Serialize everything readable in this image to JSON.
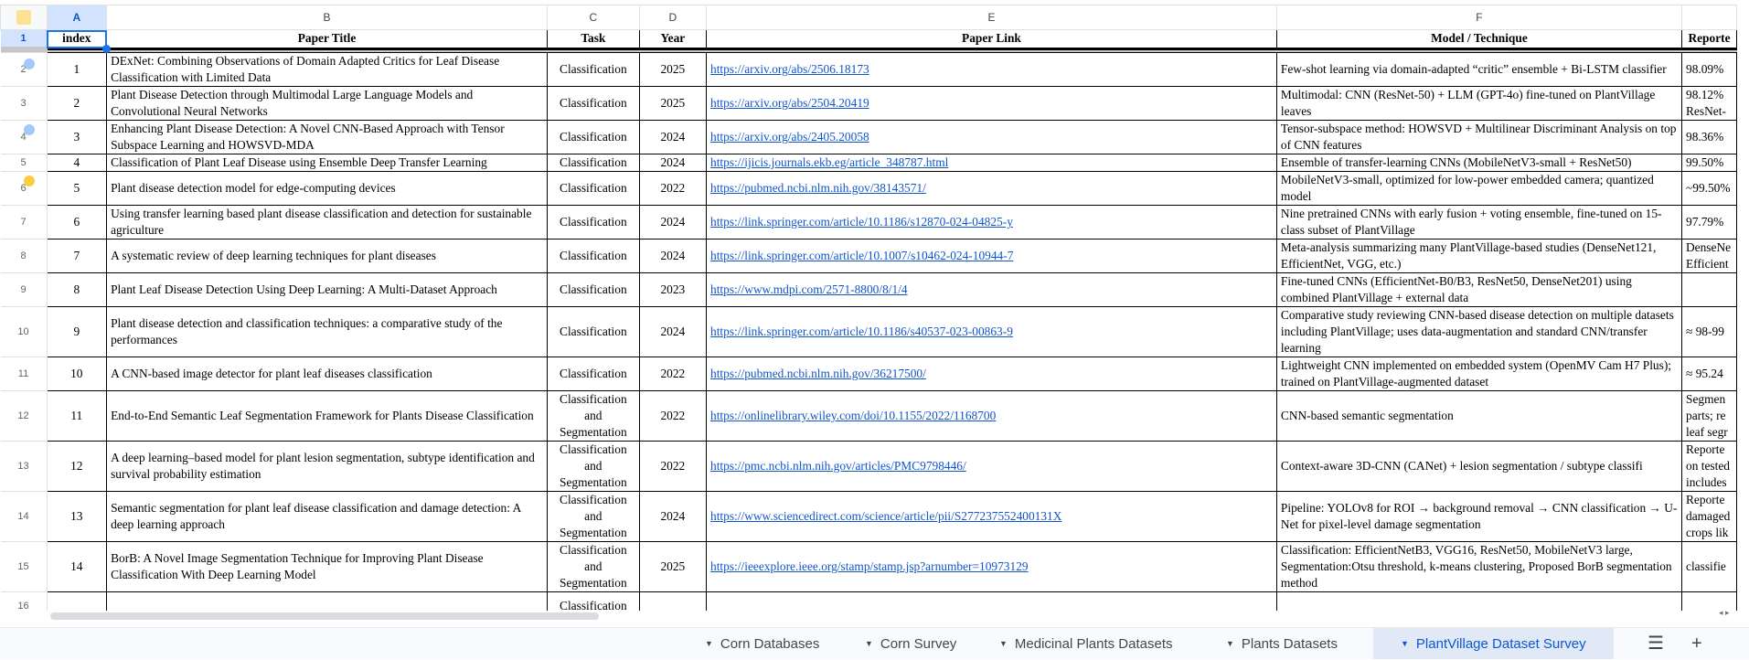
{
  "columns": [
    "A",
    "B",
    "C",
    "D",
    "E",
    "F",
    ""
  ],
  "headers": [
    "index",
    "Paper Title",
    "Task",
    "Year",
    "Paper Link",
    "Model / Technique",
    "Reporte"
  ],
  "rows": [
    {
      "num": "2",
      "index": "1",
      "title": "DExNet: Combining Observations of Domain Adapted Critics for Leaf Disease Classification with Limited Data",
      "task": "Classification",
      "year": "2025",
      "link": "https://arxiv.org/abs/2506.18173",
      "model": "Few-shot learning via domain-adapted “critic” ensemble + Bi-LSTM classifier",
      "reported": "98.09%"
    },
    {
      "num": "3",
      "index": "2",
      "title": "Plant Disease Detection through Multimodal Large Language Models and Convolutional Neural Networks",
      "task": "Classification",
      "year": "2025",
      "link": "https://arxiv.org/abs/2504.20419",
      "model": "Multimodal: CNN (ResNet-50) + LLM (GPT-4o) fine-tuned on PlantVillage leaves",
      "reported": "98.12%\nResNet-"
    },
    {
      "num": "4",
      "index": "3",
      "title": "Enhancing Plant Disease Detection: A Novel CNN-Based Approach with Tensor Subspace Learning and HOWSVD-MDA",
      "task": "Classification",
      "year": "2024",
      "link": "https://arxiv.org/abs/2405.20058",
      "model": "Tensor-subspace method: HOWSVD + Multilinear Discriminant Analysis on top of CNN features",
      "reported": "98.36%"
    },
    {
      "num": "5",
      "index": "4",
      "title": "Classification of Plant Leaf Disease using Ensemble Deep Transfer Learning",
      "task": "Classification",
      "year": "2024",
      "link": "https://ijicis.journals.ekb.eg/article_348787.html",
      "model": "Ensemble of transfer-learning CNNs (MobileNetV3-small + ResNet50)",
      "reported": "99.50%"
    },
    {
      "num": "6",
      "index": "5",
      "title": "Plant disease detection model for edge-computing devices",
      "task": "Classification",
      "year": "2022",
      "link": "https://pubmed.ncbi.nlm.nih.gov/38143571/",
      "model": "MobileNetV3-small, optimized for low-power embedded camera; quantized model",
      "reported": "~99.50%"
    },
    {
      "num": "7",
      "index": "6",
      "title": "Using transfer learning based plant disease classification and detection for sustainable agriculture",
      "task": "Classification",
      "year": "2024",
      "link": "https://link.springer.com/article/10.1186/s12870-024-04825-y",
      "model": "Nine pretrained CNNs with early fusion + voting ensemble, fine-tuned on 15-class subset of PlantVillage",
      "reported": "97.79%"
    },
    {
      "num": "8",
      "index": "7",
      "title": "A systematic review of deep learning techniques for plant diseases",
      "task": "Classification",
      "year": "2024",
      "link": "https://link.springer.com/article/10.1007/s10462-024-10944-7",
      "model": "Meta-analysis summarizing many PlantVillage-based studies (DenseNet121, EfficientNet, VGG, etc.)",
      "reported": "DenseNe\nEfficient"
    },
    {
      "num": "9",
      "index": "8",
      "title": "Plant Leaf Disease Detection Using Deep Learning: A Multi-Dataset Approach",
      "task": "Classification",
      "year": "2023",
      "link": "https://www.mdpi.com/2571-8800/8/1/4",
      "model": "Fine-tuned CNNs (EfficientNet-B0/B3, ResNet50, DenseNet201) using combined PlantVillage + external data",
      "reported": ""
    },
    {
      "num": "10",
      "index": "9",
      "title": "Plant disease detection and classification techniques: a comparative study of the performances",
      "task": "Classification",
      "year": "2024",
      "link": "https://link.springer.com/article/10.1186/s40537-023-00863-9",
      "model": "Comparative study reviewing CNN-based disease detection on multiple datasets including PlantVillage; uses data-augmentation and standard CNN/transfer learning",
      "reported": "≈ 98-99"
    },
    {
      "num": "11",
      "index": "10",
      "title": "A CNN-based image detector for plant leaf diseases classification",
      "task": "Classification",
      "year": "2022",
      "link": "https://pubmed.ncbi.nlm.nih.gov/36217500/",
      "model": "Lightweight CNN implemented on embedded system (OpenMV Cam H7 Plus); trained on PlantVillage-augmented dataset",
      "reported": "≈ 95.24"
    },
    {
      "num": "12",
      "index": "11",
      "title": "End-to-End Semantic Leaf Segmentation Framework for Plants Disease Classification",
      "task": "Classification and Segmentation",
      "year": "2022",
      "link": "https://onlinelibrary.wiley.com/doi/10.1155/2022/1168700",
      "model": "CNN-based semantic segmentation",
      "reported": "Segmen\nparts; re\nleaf segr"
    },
    {
      "num": "13",
      "index": "12",
      "title": "A deep learning–based model for plant lesion segmentation, subtype identification and survival probability estimation",
      "task": "Classification and Segmentation",
      "year": "2022",
      "link": "https://pmc.ncbi.nlm.nih.gov/articles/PMC9798446/",
      "model": "Context-aware 3D-CNN (CANet) + lesion segmentation / subtype classifi",
      "reported": "Reporte\non tested\nincludes"
    },
    {
      "num": "14",
      "index": "13",
      "title": "Semantic segmentation for plant leaf disease classification and damage detection: A deep learning approach",
      "task": "Classification and Segmentation",
      "year": "2024",
      "link": "https://www.sciencedirect.com/science/article/pii/S277237552400131X",
      "model": "Pipeline: YOLOv8 for ROI → background removal → CNN classification → U-Net for pixel-level damage segmentation",
      "reported": "Reporte\ndamaged\ncrops lik"
    },
    {
      "num": "15",
      "index": "14",
      "title": "BorB: A Novel Image Segmentation Technique for Improving Plant Disease Classification With Deep Learning Model",
      "task": "Classification and Segmentation",
      "year": "2025",
      "link": "https://ieeexplore.ieee.org/stamp/stamp.jsp?arnumber=10973129",
      "model": "Classification: EfficientNetB3, VGG16, ResNet50, MobileNetV3 large, Segmentation:Otsu threshold, k-means clustering, Proposed BorB segmentation method",
      "reported": "classifie"
    },
    {
      "num": "16",
      "index": "",
      "title": "",
      "task": "Classification",
      "year": "",
      "link": "",
      "model": "",
      "reported": ""
    }
  ],
  "header_row_num": "1",
  "sheet_tabs": [
    "Corn Databases",
    "Corn Survey",
    "Medicinal Plants Datasets",
    "Plants Datasets",
    "PlantVillage Dataset Survey"
  ],
  "active_tab": "PlantVillage Dataset Survey",
  "icons": {
    "all_sheets": "☰",
    "add_sheet": "+"
  },
  "colors": {
    "accent": "#0b57d0",
    "link": "#1155cc"
  }
}
